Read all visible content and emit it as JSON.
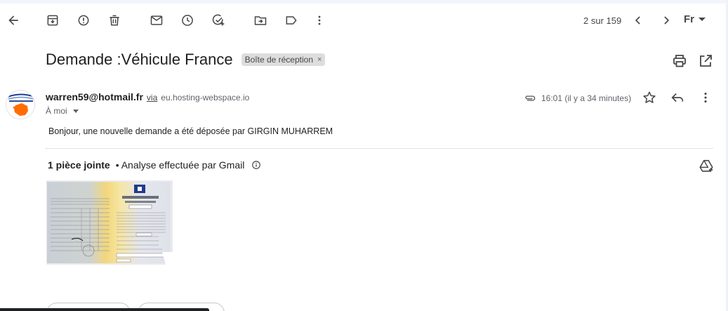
{
  "toolbar": {
    "back": "arrow-back-icon",
    "archive": "archive-icon",
    "spam": "report-spam-icon",
    "delete": "delete-icon",
    "mark_unread": "mail-icon",
    "snooze": "clock-icon",
    "add_task": "add-task-icon",
    "move": "move-to-icon",
    "labels": "label-icon",
    "more": "more-vert-icon",
    "pager": "2 sur 159",
    "prev": "chevron-left-icon",
    "next": "chevron-right-icon",
    "input_tool": "Fr"
  },
  "message": {
    "subject": "Demande :Véhicule France",
    "label": "Boîte de réception",
    "label_remove": "×",
    "sender_email": "warren59@hotmail.fr",
    "via": "via",
    "via_domain": "eu.hosting-webspace.io",
    "to": "À moi",
    "time": "16:01 (il y a 34 minutes)",
    "body": "Bonjour, une nouvelle demande a été déposée par GIRGIN MUHARREM"
  },
  "attachments": {
    "count_label": "1 pièce jointe",
    "scan_note": "• Analyse effectuée par Gmail"
  },
  "colors": {
    "icon": "#444746",
    "text": "#1f1f1f",
    "chip_bg": "#dddddd",
    "avatar_accent": "#ff6d00"
  }
}
